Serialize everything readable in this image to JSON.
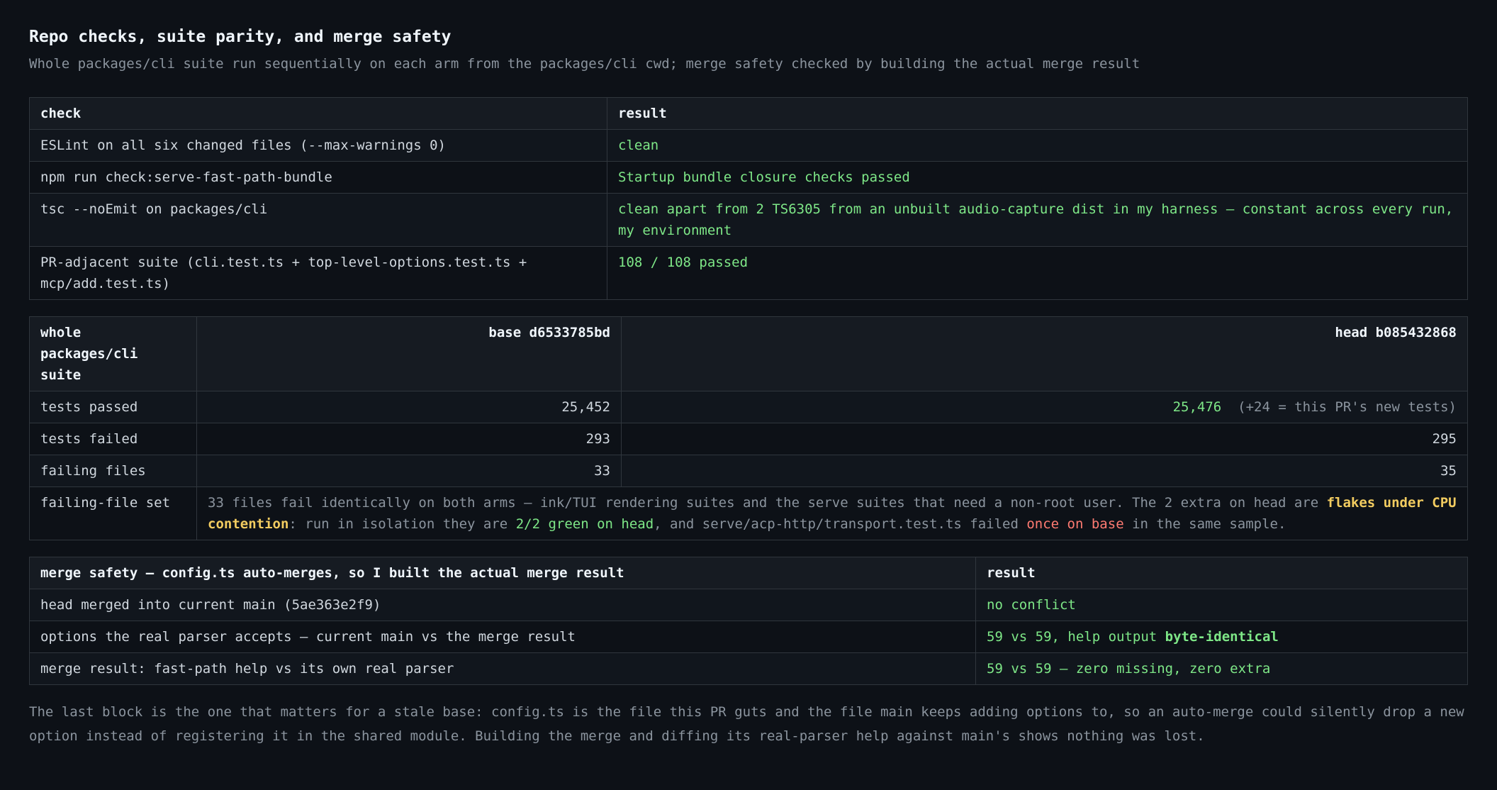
{
  "header": {
    "title": "Repo checks, suite parity, and merge safety",
    "subtitle": "Whole packages/cli suite run sequentially on each arm from the packages/cli cwd; merge safety checked by building the actual merge result"
  },
  "checks_table": {
    "headers": [
      "check",
      "result"
    ],
    "rows": [
      {
        "check": "ESLint on all six changed files (--max-warnings 0)",
        "result": "clean"
      },
      {
        "check": "npm run check:serve-fast-path-bundle",
        "result": "Startup bundle closure checks passed"
      },
      {
        "check": "tsc --noEmit on packages/cli",
        "result": "clean apart from 2 TS6305 from an unbuilt audio-capture dist in my harness — constant across every run, my environment"
      },
      {
        "check": "PR-adjacent suite (cli.test.ts + top-level-options.test.ts + mcp/add.test.ts)",
        "result": "108 / 108 passed"
      }
    ]
  },
  "suite_table": {
    "headers": [
      "whole packages/cli suite",
      "base d6533785bd",
      "head b085432868"
    ],
    "rows": [
      {
        "label": "tests passed",
        "base": "25,452",
        "head": "25,476",
        "head_note": "(+24 = this PR's new tests)"
      },
      {
        "label": "tests failed",
        "base": "293",
        "head": "295"
      },
      {
        "label": "failing files",
        "base": "33",
        "head": "35"
      }
    ],
    "failing_set": {
      "label": "failing-file set",
      "t1": "33 files fail identically on both arms — ink/TUI rendering suites and the serve suites that need a non-root user. The 2 extra on head are ",
      "flakes": "flakes under CPU contention",
      "t2": ": run in isolation they are ",
      "green": "2/2 green on head",
      "t3": ", and serve/acp-http/transport.test.ts failed ",
      "red": "once on base",
      "t4": " in the same sample."
    }
  },
  "merge_table": {
    "headers": [
      "merge safety — config.ts auto-merges, so I built the actual merge result",
      "result"
    ],
    "rows": [
      {
        "check": "head merged into current main (5ae363e2f9)",
        "result": "no conflict"
      },
      {
        "check": "options the real parser accepts — current main vs the merge result",
        "result": "59 vs 59, help output ",
        "result_bold": "byte-identical"
      },
      {
        "check": "merge result: fast-path help vs its own real parser",
        "result": "59 vs 59 — zero missing, zero extra"
      }
    ]
  },
  "footnote": "The last block is the one that matters for a stale base: config.ts is the file this PR guts and the file main keeps adding options to, so an auto-merge could silently drop a new option instead of registering it in the shared module. Building the merge and diffing its real-parser help against main's shows nothing was lost.",
  "colors": {
    "background": "#0d1117",
    "header_bg": "#161b22",
    "border": "#30363d",
    "success": "#7ee787",
    "warning": "#f2cc60",
    "danger": "#ff7b72",
    "muted": "#8b949e"
  }
}
